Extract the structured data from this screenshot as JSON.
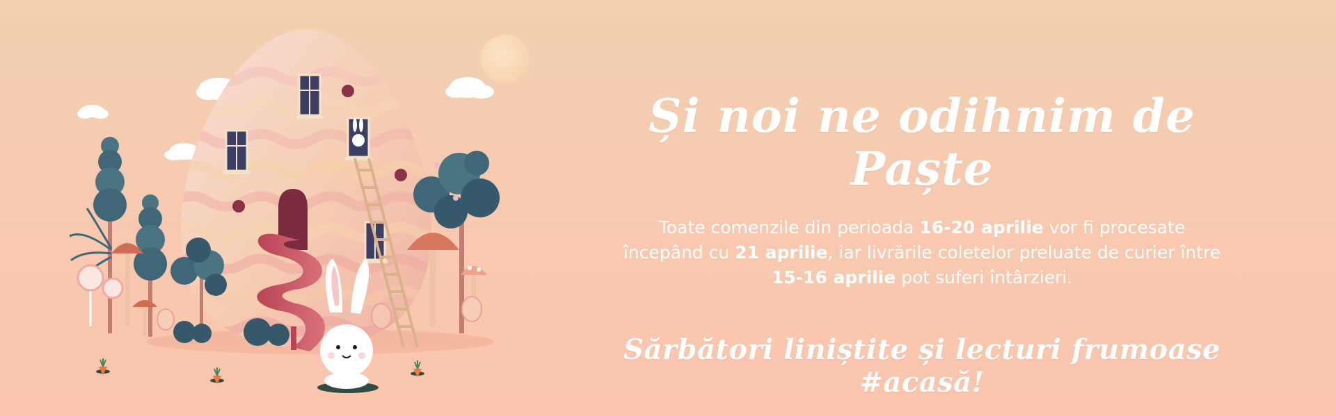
{
  "banner": {
    "headline": "Și noi ne odihnim de Paște",
    "body": {
      "part1": "Toate comenzile din perioada ",
      "bold1": "16-20 aprilie",
      "part2": " vor fi procesate începând cu ",
      "bold2": "21 aprilie",
      "part3": ", iar livrările coletelor preluate de curier între ",
      "bold3": "15-16 aprilie",
      "part4": " pot suferi întârzieri."
    },
    "closing": "Sărbători liniștite și lecturi frumoase #acasă!"
  },
  "colors": {
    "bg_top": "#f2d0b0",
    "bg_bottom": "#fbc4ad",
    "text": "#ffffff",
    "egg_pink": "#f3b3ad",
    "egg_peach": "#f6cfa8",
    "tree_teal": "#3f6777",
    "slide_red": "#c7505e",
    "window_navy": "#3c3f63"
  }
}
